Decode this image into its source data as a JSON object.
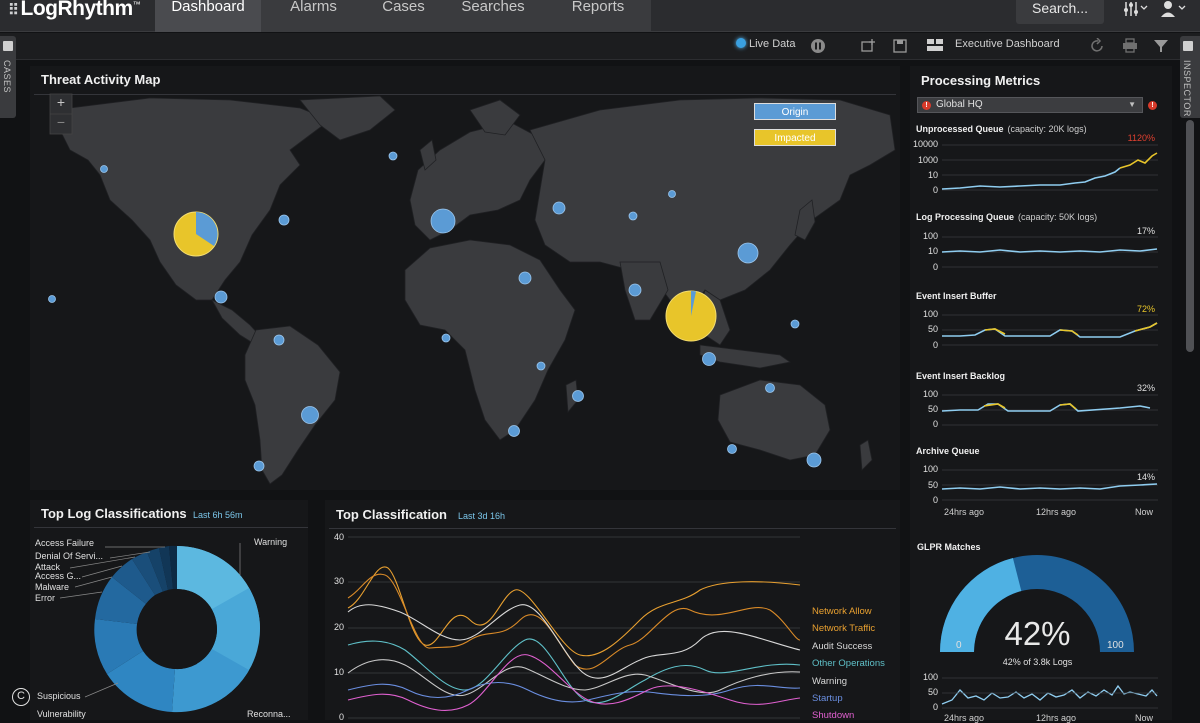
{
  "app": {
    "logo": "LogRhythm",
    "search_label": "Search..."
  },
  "nav": {
    "tabs": [
      "Dashboard",
      "Alarms",
      "Cases",
      "Searches",
      "Reports"
    ],
    "active": "Dashboard"
  },
  "toolbar": {
    "live_data": "Live Data",
    "layout_name": "Executive Dashboard"
  },
  "side": {
    "left_label": "CASES",
    "right_label": "INSPECTOR"
  },
  "threat_map": {
    "title": "Threat Activity Map",
    "zoom_in": "+",
    "zoom_out": "−",
    "legend": {
      "origin": "Origin",
      "impacted": "Impacted"
    },
    "colors": {
      "origin": "#5b9bd5",
      "impacted": "#e8c52a"
    }
  },
  "top_log": {
    "title": "Top Log Classifications",
    "range": "Last 6h 56m",
    "labels": [
      "Access Failure",
      "Denial Of Servi...",
      "Attack",
      "Access G...",
      "Malware",
      "Error",
      "Warning",
      "Suspicious",
      "Vulnerability",
      "Reconna..."
    ]
  },
  "top_class": {
    "title": "Top Classification",
    "range": "Last 3d 16h",
    "y_ticks": [
      "40",
      "30",
      "20",
      "10",
      "0"
    ],
    "series": [
      {
        "name": "Network Allow",
        "color": "#e8a030"
      },
      {
        "name": "Network Traffic",
        "color": "#e8a030"
      },
      {
        "name": "Audit Success",
        "color": "#d8d8d8"
      },
      {
        "name": "Other Operations",
        "color": "#5fc0c8"
      },
      {
        "name": "Warning",
        "color": "#d8d8d8"
      },
      {
        "name": "Startup",
        "color": "#6a8ee0"
      },
      {
        "name": "Shutdown",
        "color": "#e060d0"
      }
    ]
  },
  "metrics": {
    "title": "Processing Metrics",
    "site": "Global HQ",
    "queues": [
      {
        "name": "Unprocessed Queue",
        "capacity": "(capacity: 20K logs)",
        "value": "1120%",
        "value_color": "#e04030",
        "ticks": [
          "10000",
          "1000",
          "10",
          "0"
        ]
      },
      {
        "name": "Log Processing Queue",
        "capacity": "(capacity: 50K logs)",
        "value": "17%",
        "value_color": "#e0e0e0",
        "ticks": [
          "100",
          "10",
          "0"
        ]
      },
      {
        "name": "Event Insert Buffer",
        "capacity": "",
        "value": "72%",
        "value_color": "#e8c52a",
        "ticks": [
          "100",
          "50",
          "0"
        ]
      },
      {
        "name": "Event Insert Backlog",
        "capacity": "",
        "value": "32%",
        "value_color": "#e0e0e0",
        "ticks": [
          "100",
          "50",
          "0"
        ]
      },
      {
        "name": "Archive Queue",
        "capacity": "",
        "value": "14%",
        "value_color": "#e0e0e0",
        "ticks": [
          "100",
          "50",
          "0"
        ]
      }
    ],
    "x_labels": [
      "24hrs ago",
      "12hrs ago",
      "Now"
    ],
    "glpr": {
      "title": "GLPR Matches",
      "value": "42%",
      "sub": "42% of 3.8k Logs",
      "min": "0",
      "max": "100",
      "fraction": 0.42,
      "ticks": [
        "100",
        "50",
        "0"
      ],
      "x_labels": [
        "24hrs ago",
        "12hrs ago",
        "Now"
      ]
    }
  }
}
